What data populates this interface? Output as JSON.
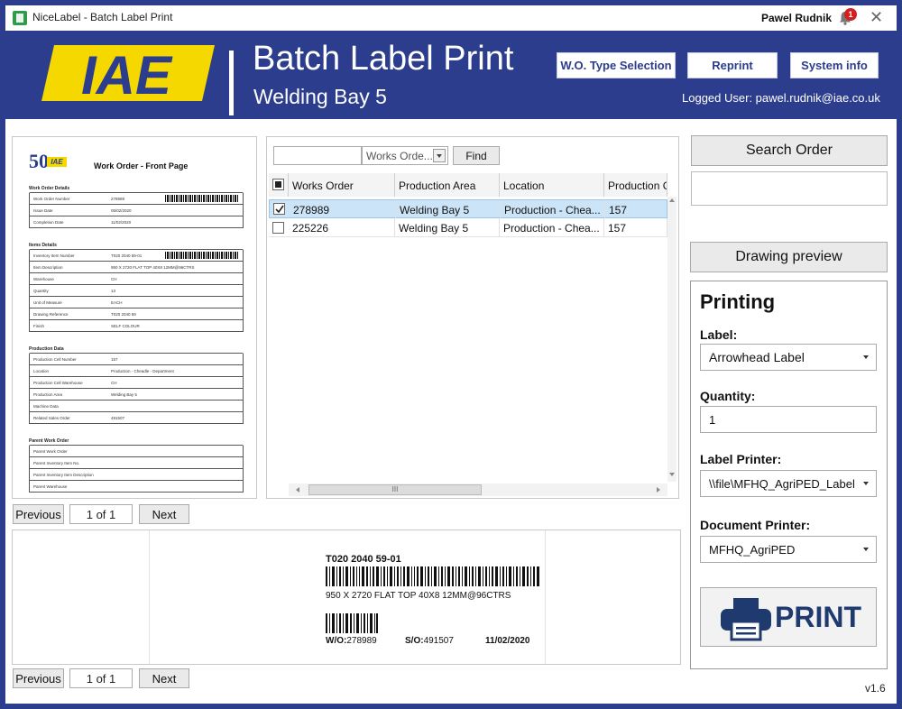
{
  "titlebar": {
    "app_title": "NiceLabel - Batch Label Print",
    "user": "Pawel Rudnik",
    "notification_count": "1",
    "close_glyph": "✕"
  },
  "header": {
    "logo_text": "IAE",
    "title": "Batch Label Print",
    "subtitle": "Welding Bay 5",
    "buttons": {
      "wo_type": "W.O. Type Selection",
      "reprint": "Reprint",
      "system_info": "System info"
    },
    "logged_user": "Logged User: pawel.rudnik@iae.co.uk"
  },
  "document_preview": {
    "logo_50": "50",
    "logo_iae": "IAE",
    "heading": "Work Order - Front Page",
    "sections": [
      {
        "title": "Work Order Details",
        "rows": [
          [
            "Work Order Number",
            "278989"
          ],
          [
            "Issue Date",
            "05/02/2020"
          ],
          [
            "Completion Date",
            "11/02/2020"
          ]
        ]
      },
      {
        "title": "Items Details",
        "rows": [
          [
            "Inventory Item Number",
            "T020 2040 59-01"
          ],
          [
            "Item Description",
            "950 X 2720 FLAT TOP 40X8 12MM@96CTRS"
          ],
          [
            "Warehouse",
            "CH"
          ],
          [
            "Quantity",
            "13"
          ],
          [
            "Unit of Measure",
            "EACH"
          ],
          [
            "Drawing Reference",
            "T020 2040 59"
          ],
          [
            "Finish",
            "SELF COLOUR"
          ]
        ]
      },
      {
        "title": "Production Data",
        "rows": [
          [
            "Production Cell Number",
            "157"
          ],
          [
            "Location",
            "Production - Cheadle - Department"
          ],
          [
            "Production Cell Warehouse",
            "CH"
          ],
          [
            "Production Area",
            "Welding Bay 5"
          ],
          [
            "Machine Data",
            ""
          ],
          [
            "Related Sales Order",
            "491507"
          ]
        ]
      },
      {
        "title": "Parent Work Order",
        "rows": [
          [
            "Parent Work Order",
            ""
          ],
          [
            "Parent Inventory Item No.",
            ""
          ],
          [
            "Parent Inventory Item Description",
            ""
          ],
          [
            "Parent Warehouse",
            ""
          ]
        ]
      }
    ]
  },
  "pager_top": {
    "previous": "Previous",
    "page": "1 of 1",
    "next": "Next"
  },
  "pager_bottom": {
    "previous": "Previous",
    "page": "1 of 1",
    "next": "Next"
  },
  "search": {
    "value": "",
    "filter_selected": "Works Orde...",
    "find": "Find"
  },
  "grid": {
    "columns": [
      "Works Order",
      "Production Area",
      "Location",
      "Production C"
    ],
    "rows": [
      {
        "checked": true,
        "cells": [
          "278989",
          "Welding Bay 5",
          "Production - Chea...",
          "157"
        ]
      },
      {
        "checked": false,
        "cells": [
          "225226",
          "Welding Bay 5",
          "Production - Chea...",
          "157"
        ]
      }
    ],
    "scroll_grip": "III"
  },
  "label_preview": {
    "item_number": "T020 2040 59-01",
    "description": "950 X 2720 FLAT TOP 40X8 12MM@96CTRS",
    "wo_prefix": "W/O:",
    "wo": "278989",
    "so_prefix": "S/O:",
    "so": "491507",
    "date": "11/02/2020"
  },
  "right_panel": {
    "search_order": "Search Order",
    "search_order_value": "",
    "drawing_preview": "Drawing preview",
    "printing_title": "Printing",
    "label_label": "Label:",
    "label_value": "Arrowhead Label",
    "quantity_label": "Quantity:",
    "quantity_value": "1",
    "label_printer_label": "Label Printer:",
    "label_printer_value": "\\\\file\\MFHQ_AgriPED_Label",
    "document_printer_label": "Document Printer:",
    "document_printer_value": "MFHQ_AgriPED",
    "print_button": "PRINT"
  },
  "version": "v1.6",
  "colors": {
    "brand_blue": "#2b3d8c",
    "logo_yellow": "#f5d800",
    "selection": "#cce4f7",
    "print_icon": "#1f3a6e"
  },
  "icons": [
    "bell-icon",
    "close-icon",
    "print-icon",
    "chevron-down-icon",
    "checkbox-icon"
  ]
}
